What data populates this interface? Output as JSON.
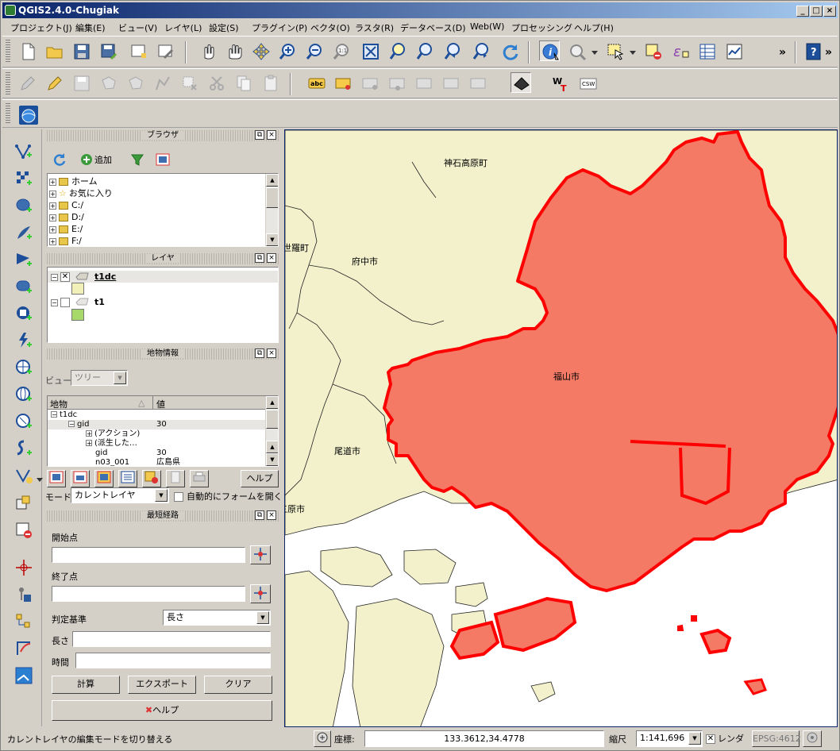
{
  "window": {
    "title": "QGIS2.4.0-Chugiak",
    "controls": [
      "_",
      "□",
      "×"
    ]
  },
  "menubar": [
    "プロジェクト(J)",
    "編集(E)",
    "ビュー(V)",
    "レイヤ(L)",
    "設定(S)",
    "プラグイン(P)",
    "ベクタ(O)",
    "ラスタ(R)",
    "データベース(D)",
    "Web(W)",
    "プロセッシング",
    "ヘルプ(H)"
  ],
  "toolbar": {
    "overflow": "»",
    "label_abc": "abc",
    "wkt": "WKT",
    "csw": "CSW"
  },
  "browser_panel": {
    "title": "ブラウザ",
    "add_label": "追加",
    "items": [
      "ホーム",
      "お気に入り",
      "C:/",
      "D:/",
      "E:/",
      "F:/"
    ]
  },
  "layers_panel": {
    "title": "レイヤ",
    "layers": [
      {
        "name": "t1dc",
        "checked": true,
        "swatch": "#f0f0b8"
      },
      {
        "name": "t1",
        "checked": false,
        "swatch": "#a6d96a"
      }
    ]
  },
  "identify_panel": {
    "title": "地物情報",
    "view_label": "ビュー",
    "view_value": "ツリー",
    "col_feature": "地物",
    "col_value": "値",
    "rows": [
      {
        "indent": 0,
        "expander": "-",
        "label": "t1dc",
        "value": ""
      },
      {
        "indent": 1,
        "expander": "-",
        "label": "gid",
        "value": "30"
      },
      {
        "indent": 2,
        "expander": "+",
        "label": "(アクション)",
        "value": ""
      },
      {
        "indent": 2,
        "expander": "+",
        "label": "(派生した…",
        "value": ""
      },
      {
        "indent": 2,
        "expander": "",
        "label": "gid",
        "value": "30"
      },
      {
        "indent": 2,
        "expander": "",
        "label": "n03_001",
        "value": "広島県"
      }
    ],
    "help_label": "ヘルプ",
    "mode_label": "モード",
    "mode_value": "カレントレイヤ",
    "auto_form_label": "自動的にフォームを開く"
  },
  "route_panel": {
    "title": "最短経路",
    "start_label": "開始点",
    "end_label": "終了点",
    "criterion_label": "判定基準",
    "criterion_value": "長さ",
    "length_label": "長さ",
    "time_label": "時間",
    "calc_label": "計算",
    "export_label": "エクスポート",
    "clear_label": "クリア",
    "help_label": "ヘルプ"
  },
  "map": {
    "labels": [
      {
        "text": "神石高原町"
      },
      {
        "text": "世羅町"
      },
      {
        "text": "府中市"
      },
      {
        "text": "福山市"
      },
      {
        "text": "尾道市"
      },
      {
        "text": "三原市"
      }
    ],
    "colors": {
      "land": "#f2f1cc",
      "selected_fill": "#f47a66",
      "selected_stroke": "#ff0000",
      "sea": "#ffffff"
    }
  },
  "statusbar": {
    "message": "カレントレイヤの編集モードを切り替える",
    "coord_label": "座標:",
    "coord_value": "133.3612,34.4778",
    "scale_label": "縮尺",
    "scale_value": "1:141,696",
    "render_label": "レンダ",
    "crs": "EPSG:4612"
  }
}
